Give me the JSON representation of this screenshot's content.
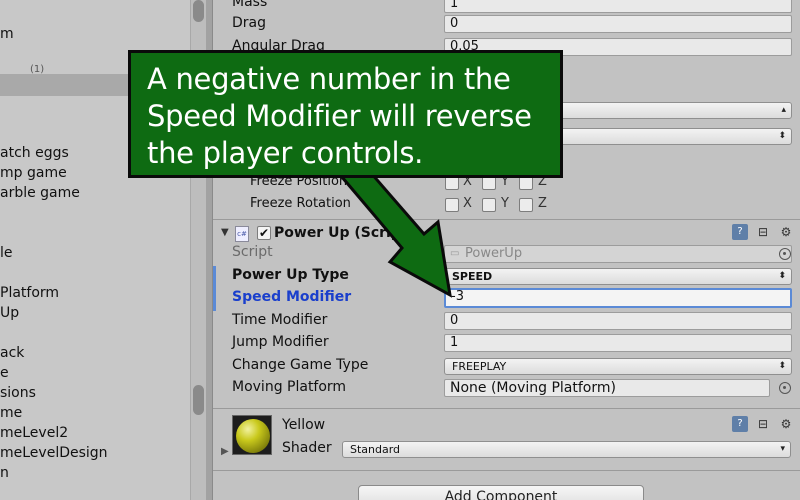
{
  "hierarchy": {
    "items": [
      {
        "label": "m"
      },
      {
        "label": "atch eggs"
      },
      {
        "label": "mp game"
      },
      {
        "label": "arble game"
      },
      {
        "label": "le"
      },
      {
        "label": "Platform"
      },
      {
        "label": "Up"
      },
      {
        "label": "ack"
      },
      {
        "label": "e"
      },
      {
        "label": "sions"
      },
      {
        "label": "me"
      },
      {
        "label": "meLevel2"
      },
      {
        "label": "meLevelDesign"
      },
      {
        "label": "n"
      }
    ],
    "band_tag": "(1)"
  },
  "rigidbody": {
    "mass_label": "Mass",
    "mass_value": "1",
    "drag_label": "Drag",
    "drag_value": "0",
    "angular_drag_label": "Angular Drag",
    "angular_drag_value": "0.05",
    "freeze_position_label": "Freeze Position",
    "freeze_rotation_label": "Freeze Rotation",
    "axis_x": "X",
    "axis_y": "Y",
    "axis_z": "Z"
  },
  "powerup": {
    "title": "Power Up (Script)",
    "script_label": "Script",
    "script_value": "PowerUp",
    "type_label": "Power Up Type",
    "type_value": "SPEED",
    "speed_label": "Speed Modifier",
    "speed_value": "-3",
    "time_label": "Time Modifier",
    "time_value": "0",
    "jump_label": "Jump Modifier",
    "jump_value": "1",
    "game_type_label": "Change Game Type",
    "game_type_value": "FREEPLAY",
    "moving_label": "Moving Platform",
    "moving_value": "None (Moving Platform)"
  },
  "material": {
    "name": "Yellow",
    "shader_label": "Shader",
    "shader_value": "Standard",
    "sphere_color": "#b5b510"
  },
  "add_component_label": "Add Component",
  "callout": {
    "text": "A negative number in the Speed Modifier will reverse the player controls.",
    "bg_color": "#0e6b12"
  }
}
